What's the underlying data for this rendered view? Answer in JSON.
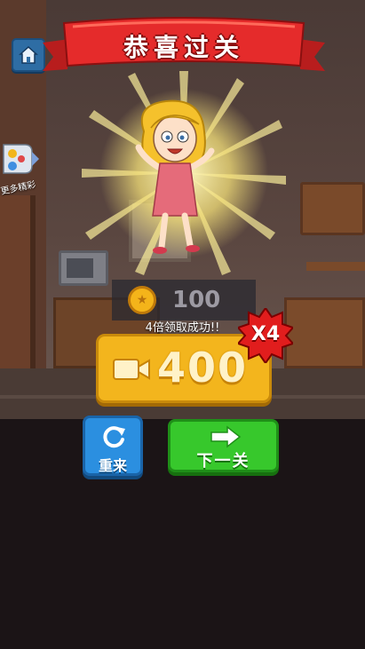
{
  "header": {
    "title": "恭喜过关",
    "home_icon": "home-icon"
  },
  "side": {
    "more_games_label": "更多精彩",
    "icon": "gamepad-icon"
  },
  "reward": {
    "coin_icon": "coin-icon",
    "coin_amount": "100",
    "success_message": "4倍领取成功!!",
    "video_icon": "video-camera-icon",
    "video_reward_amount": "400",
    "multiplier": "X4"
  },
  "actions": {
    "retry_label": "重来",
    "retry_icon": "refresh-icon",
    "next_label": "下一关",
    "next_icon": "arrow-right-icon"
  },
  "colors": {
    "ribbon": "#e52b2b",
    "reward_button": "#f3b51d",
    "retry_button": "#2b8fe0",
    "next_button": "#37c82c",
    "badge": "#e11d1d"
  }
}
